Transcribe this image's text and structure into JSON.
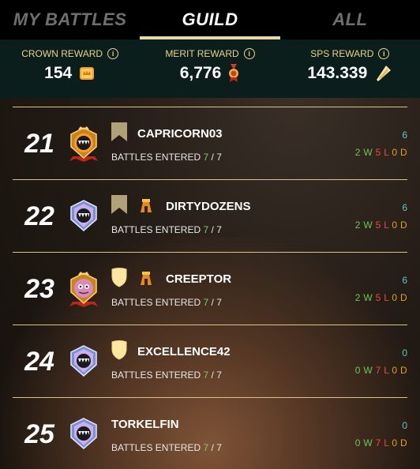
{
  "tabs": [
    {
      "label": "MY BATTLES",
      "active": false
    },
    {
      "label": "GUILD",
      "active": true
    },
    {
      "label": "ALL",
      "active": false
    }
  ],
  "rewards": [
    {
      "label": "CROWN REWARD",
      "value": "154",
      "icon": "crown-icon",
      "info": "i"
    },
    {
      "label": "MERIT REWARD",
      "value": "6,776",
      "icon": "merit-medal-icon",
      "info": "i"
    },
    {
      "label": "SPS REWARD",
      "value": "143.339",
      "icon": "sps-token-icon",
      "info": "i"
    }
  ],
  "battles_label": "BATTLES ENTERED",
  "players": [
    {
      "rank": "21",
      "name": "CAPRICORN03",
      "league": "gold",
      "banner": "brown",
      "tower": false,
      "entered": "7",
      "total": "7",
      "score": "6",
      "w": "2",
      "l": "5",
      "d": "0"
    },
    {
      "rank": "22",
      "name": "DIRTYDOZENS",
      "league": "diamond",
      "banner": "brown",
      "tower": true,
      "entered": "7",
      "total": "7",
      "score": "6",
      "w": "2",
      "l": "5",
      "d": "0"
    },
    {
      "rank": "23",
      "name": "CREEPTOR",
      "league": "avatar",
      "banner": "shield",
      "tower": true,
      "entered": "7",
      "total": "7",
      "score": "6",
      "w": "2",
      "l": "5",
      "d": "0"
    },
    {
      "rank": "24",
      "name": "EXCELLENCE42",
      "league": "diamond",
      "banner": "shield",
      "tower": false,
      "entered": "7",
      "total": "7",
      "score": "0",
      "w": "0",
      "l": "7",
      "d": "0"
    },
    {
      "rank": "25",
      "name": "TORKELFIN",
      "league": "diamond",
      "banner": "none",
      "tower": false,
      "entered": "7",
      "total": "7",
      "score": "0",
      "w": "0",
      "l": "7",
      "d": "0"
    }
  ],
  "stat_letters": {
    "w": "W",
    "l": "L",
    "d": "D"
  },
  "colors": {
    "tab_underline": "#e8d9a8",
    "reward_bar": "#0b1e1b",
    "reward_label": "#e9d38a",
    "divider": "#d8c48a",
    "win": "#6cc55a",
    "loss": "#e64a4a",
    "draw": "#e0a020",
    "score": "#5fc6c0",
    "entered": "#7ccb6a"
  }
}
